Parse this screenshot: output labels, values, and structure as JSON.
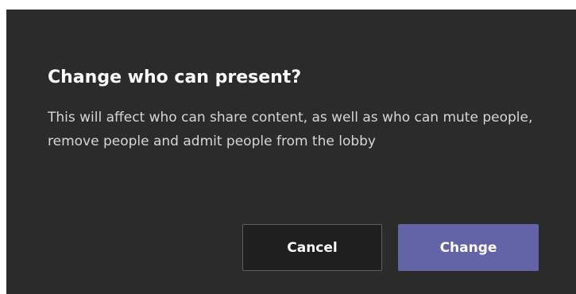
{
  "dialog": {
    "title": "Change who can present?",
    "message": "This will affect who can share content, as well as who can mute people, remove people and admit people from the lobby",
    "buttons": {
      "cancel_label": "Cancel",
      "confirm_label": "Change"
    },
    "colors": {
      "background": "#2b2b2b",
      "title_text": "#ffffff",
      "body_text": "#d6d6d6",
      "cancel_button_bg": "#1f1f1f",
      "cancel_button_border": "#5e5e5e",
      "primary_accent": "#6264a7"
    }
  }
}
